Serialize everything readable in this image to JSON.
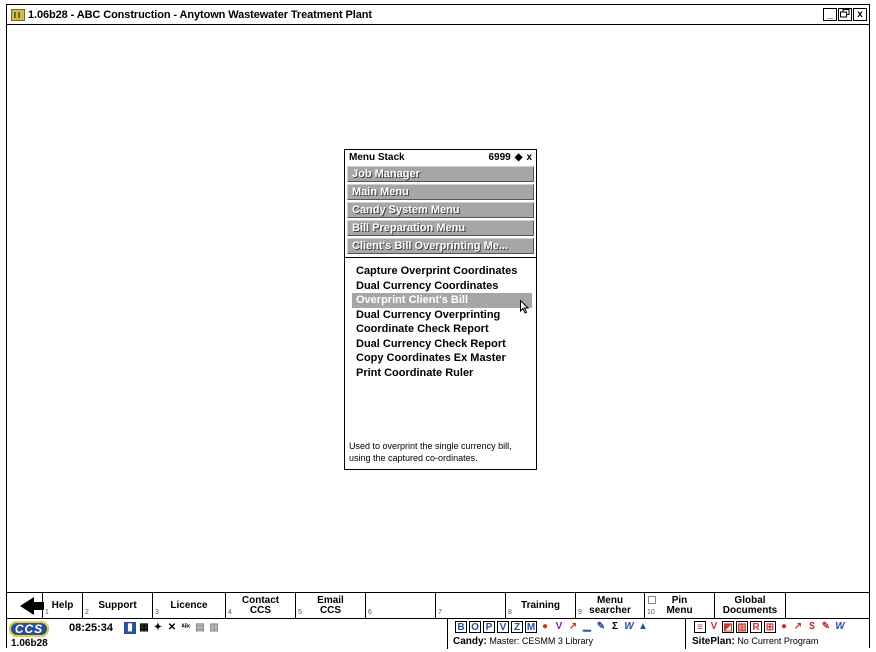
{
  "window": {
    "title": "1.06b28 - ABC Construction - Anytown Wastewater Treatment Plant",
    "controls": [
      "_",
      " ",
      "x"
    ]
  },
  "menu_stack": {
    "header_title": "Menu Stack",
    "header_code": "6999",
    "header_pin": "◆",
    "header_close": "x",
    "stack": [
      "Job Manager",
      "Main Menu",
      "Candy System Menu",
      "Bill Preparation Menu",
      "Client's Bill Overprinting Me..."
    ],
    "items": [
      "Capture Overprint Coordinates",
      "Dual Currency Coordinates",
      "Overprint Client's Bill",
      "Dual Currency Overprinting",
      "Coordinate Check Report",
      "Dual Currency Check Report",
      "Copy Coordinates Ex Master",
      "Print Coordinate Ruler"
    ],
    "selected_index": 2,
    "description_line1": "Used to overprint the single currency bill,",
    "description_line2": "using the captured co-ordinates."
  },
  "function_bar": {
    "buttons": [
      {
        "label": "Help",
        "num": "1"
      },
      {
        "label": "Support",
        "num": "2"
      },
      {
        "label": "Licence",
        "num": "3"
      },
      {
        "label": "Contact\nCCS",
        "num": "4"
      },
      {
        "label": "Email\nCCS",
        "num": "5"
      },
      {
        "label": "",
        "num": "6"
      },
      {
        "label": "",
        "num": "7"
      },
      {
        "label": "Training",
        "num": "8"
      },
      {
        "label": "Menu\nsearcher",
        "num": "9"
      },
      {
        "label": "Pin\nMenu",
        "num": "10"
      },
      {
        "label": "Global\nDocuments",
        "num": ""
      },
      {
        "label": "",
        "num": ""
      }
    ]
  },
  "status_bar": {
    "logo": "CCS",
    "version": "1.06b28",
    "time": "08:25:34",
    "candy_label": "Candy:",
    "candy_value": "Master: CESMM 3 Library",
    "siteplan_label": "SitePlan:",
    "siteplan_value": "No Current Program"
  },
  "colors": {
    "stack_button": "#a6a6a6",
    "selected_item": "#a6a6a6",
    "logo_blue": "#2a4f9a"
  }
}
